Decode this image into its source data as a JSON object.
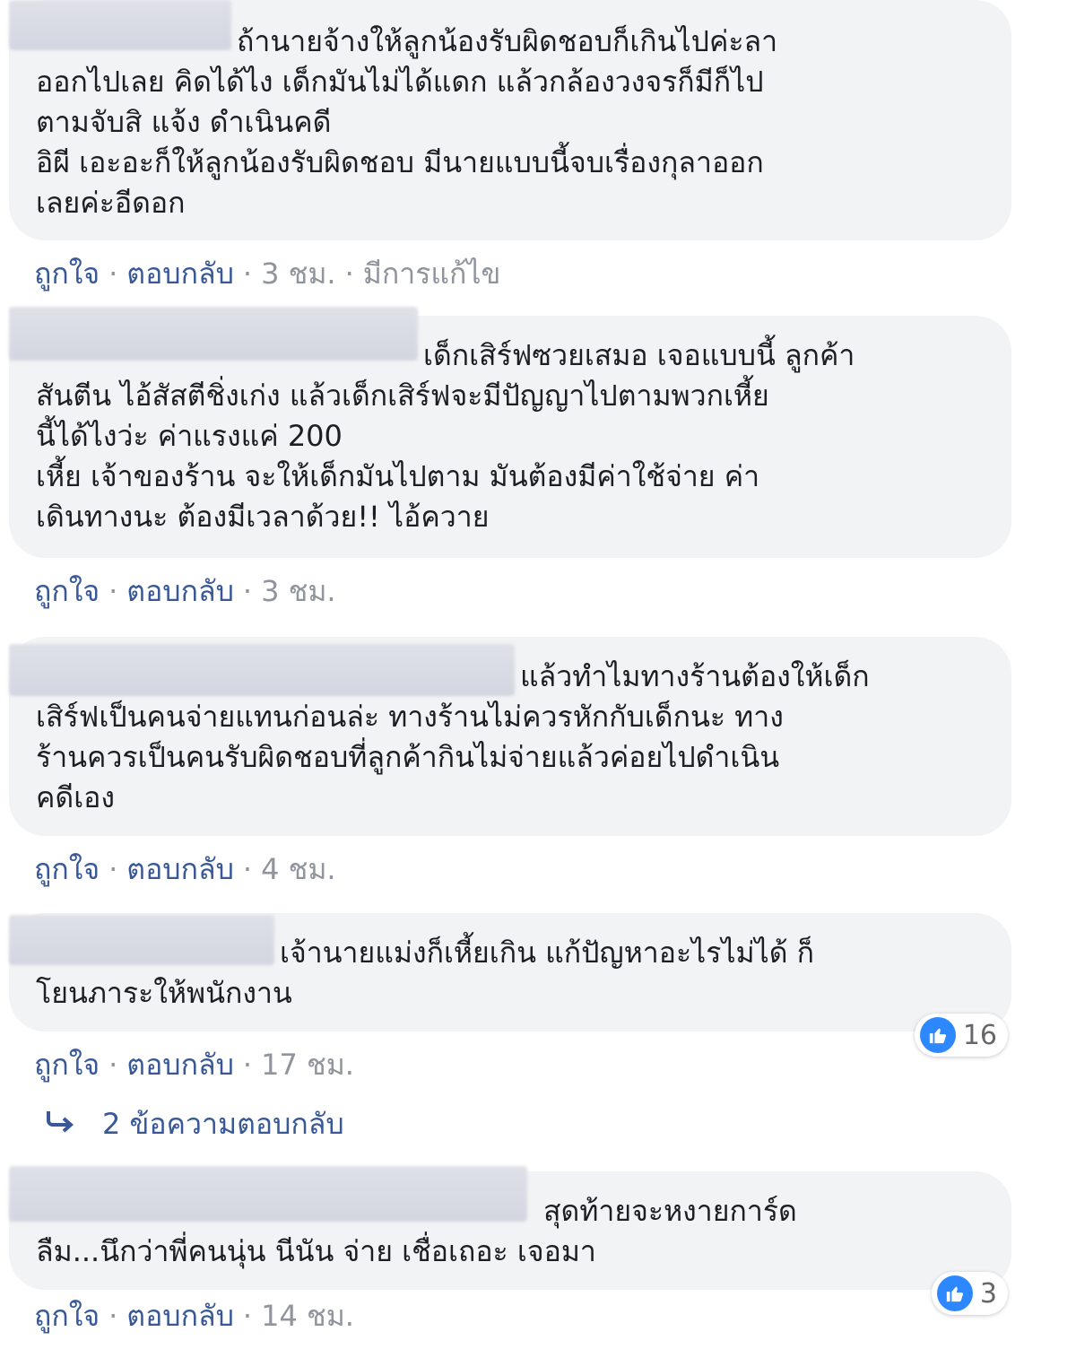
{
  "comments": [
    {
      "text": "ถ้านายจ้างให้ลูกน้องรับผิดชอบก็เกินไปค่ะลา\nออกไปเลย คิดได้ไง เด็กมันไม่ได้แดก แล้วกล้องวงจรก็มีก็ไป\nตามจับสิ แจ้ง ดำเนินคดี\nอิผี เอะอะก็ให้ลูกน้องรับผิดชอบ มีนายแบบนี้จบเรื่องกุลาออก\nเลยค่ะอีดอก",
      "like": "ถูกใจ",
      "reply": "ตอบกลับ",
      "time": "3 ชม.",
      "edited": "มีการแก้ไข"
    },
    {
      "text": "เด็กเสิร์ฟซวยเสมอ เจอแบบนี้ ลูกค้า\nสันตีน ไอ้สัสตีชิ่งเก่ง แล้วเด็กเสิร์ฟจะมีปัญญาไปตามพวกเหี้ย\nนี้ได้ไงว่ะ ค่าแรงแค่ 200\nเหี้ย เจ้าของร้าน จะให้เด็กมันไปตาม มันต้องมีค่าใช้จ่าย ค่า\nเดินทางนะ ต้องมีเวลาด้วย!! ไอ้ควาย",
      "like": "ถูกใจ",
      "reply": "ตอบกลับ",
      "time": "3 ชม."
    },
    {
      "text": "แล้วทำไมทางร้านต้องให้เด็ก\nเสิร์ฟเป็นคนจ่ายแทนก่อนล่ะ ทางร้านไม่ควรหักกับเด็กนะ ทาง\nร้านควรเป็นคนรับผิดชอบที่ลูกค้ากินไม่จ่ายแล้วค่อยไปดำเนิน\nคดีเอง",
      "like": "ถูกใจ",
      "reply": "ตอบกลับ",
      "time": "4 ชม."
    },
    {
      "text": "เจ้านายแม่งก็เหี้ยเกิน แก้ปัญหาอะไรไม่ได้ ก็\nโยนภาระให้พนักงาน",
      "like": "ถูกใจ",
      "reply": "ตอบกลับ",
      "time": "17 ชม.",
      "reaction_count": "16"
    },
    {
      "text": "สุดท้ายจะหงายการ์ด\nลืม...นึกว่าพี่คนนุ่น นีนัน จ่าย เชื่อเถอะ เจอมา",
      "like": "ถูกใจ",
      "reply": "ตอบกลับ",
      "time": "14 ชม.",
      "reaction_count": "3"
    }
  ],
  "replies_link": {
    "label": "2 ข้อความตอบกลับ",
    "icon": "reply-arrow-icon"
  },
  "colors": {
    "link": "#385898",
    "meta": "#90949c",
    "bubble": "#f2f3f5",
    "like_blue": "#2d88ff"
  }
}
